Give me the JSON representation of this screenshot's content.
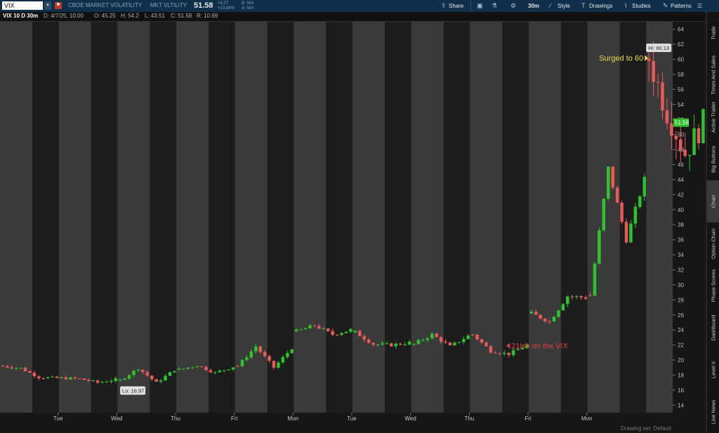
{
  "toolbar": {
    "symbol": "VIX",
    "description": "CBOE MARKET VOLATILITY",
    "short_name": "MKT VLTILITY",
    "last_price": "51.58",
    "change": "+6.27",
    "change_pct": "+13.84%",
    "bid": "B: N/A",
    "ask": "A: N/A",
    "share_label": "Share",
    "interval_label": "30m",
    "style_label": "Style",
    "drawings_label": "Drawings",
    "studies_label": "Studies",
    "patterns_label": "Patterns"
  },
  "info_bar": {
    "title": "VIX 10 D 30m",
    "date": "D: 4/7/25, 10:00",
    "open": "O: 45.25",
    "high": "H: 54.2",
    "low": "L: 43.51",
    "close": "C: 51.58",
    "range": "R: 10.69"
  },
  "side_tabs": [
    "Trade",
    "Times And Sales",
    "Active Trader",
    "Big Buttons",
    "Chart",
    "Option Chain",
    "Phase Scores",
    "Dashboard",
    "Level II",
    "Live News"
  ],
  "active_side_tab": "Chart",
  "chart_data": {
    "type": "candlestick",
    "interval": "30m",
    "days": [
      "Tue",
      "Wed",
      "Thu",
      "Fri",
      "Mon",
      "Tue",
      "Wed",
      "Thu",
      "Fri",
      "Mon"
    ],
    "ylim": [
      13,
      65
    ],
    "y_ticks": [
      14,
      16,
      18,
      20,
      22,
      24,
      26,
      28,
      30,
      32,
      34,
      36,
      38,
      40,
      42,
      44,
      46,
      48,
      50,
      52,
      54,
      56,
      58,
      60,
      62,
      64
    ],
    "daily_path": [
      [
        19.2,
        18.9,
        17.7,
        17.6
      ],
      [
        17.6,
        17.5,
        17.0,
        17.4
      ],
      [
        17.3,
        18.9,
        16.97,
        18.7
      ],
      [
        18.7,
        19.3,
        18.3,
        19.1
      ],
      [
        19.2,
        21.8,
        19.0,
        21.6
      ],
      [
        23.8,
        24.6,
        23.4,
        24.0
      ],
      [
        23.7,
        22.1,
        22.0,
        22.3
      ],
      [
        22.1,
        23.4,
        21.8,
        23.2
      ],
      [
        23.4,
        21.2,
        20.8,
        22.0
      ],
      [
        26.2,
        25.1,
        28.5,
        28.3
      ],
      [
        28.6,
        45.5,
        36.0,
        44.0
      ],
      [
        60.13,
        53.0,
        47.5,
        51.58
      ]
    ],
    "last_price_label": "51.58",
    "annotations": {
      "high_label": "Hi: 60.13",
      "low_label": "Lo: 16.97",
      "surge_text": "Surged to 60",
      "low_note": "21ish on the VIX"
    },
    "colors": {
      "up": "#2ec22e",
      "down": "#e85a5a",
      "surge": "#e8d84a",
      "note": "#e04040"
    }
  },
  "status": {
    "drawing_set": "Drawing set: Default"
  }
}
